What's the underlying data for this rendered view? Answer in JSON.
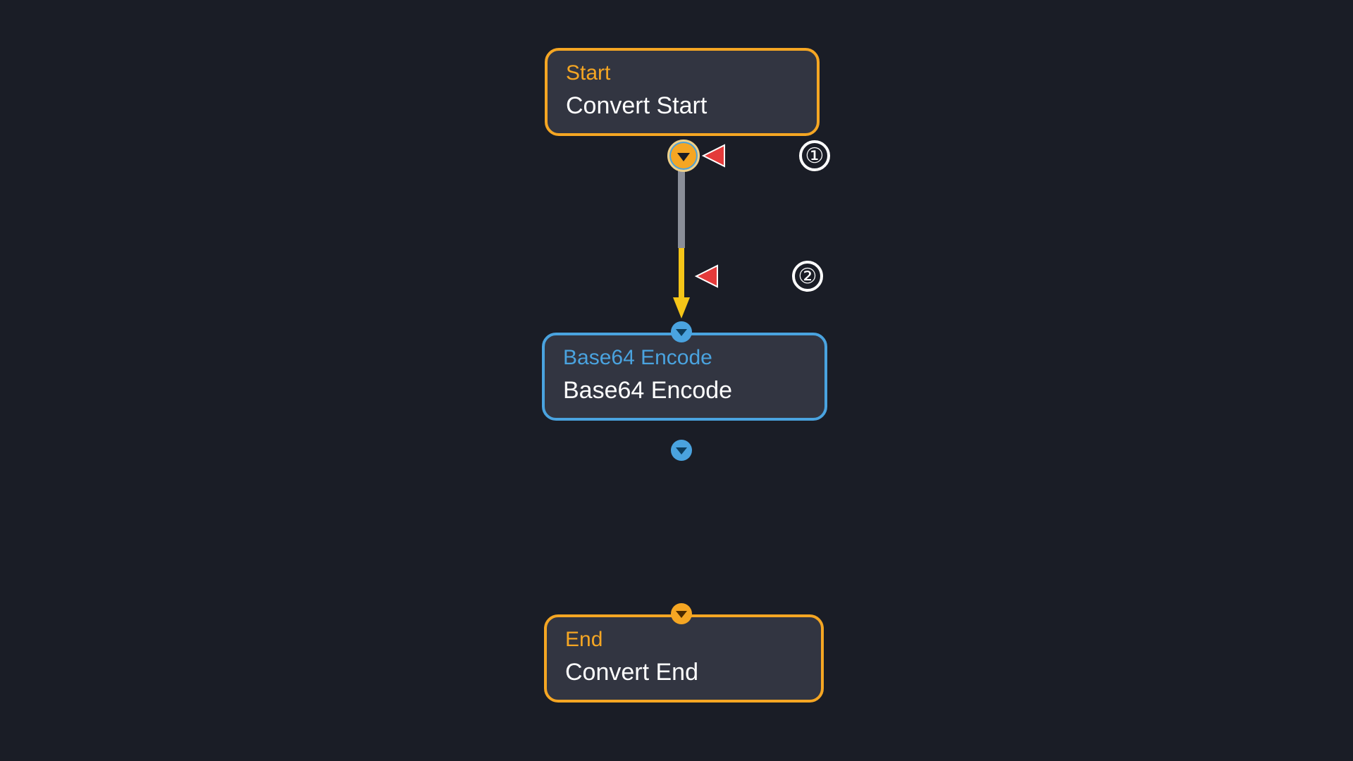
{
  "nodes": {
    "start": {
      "label": "Start",
      "title": "Convert Start"
    },
    "encode": {
      "label": "Base64 Encode",
      "title": "Base64 Encode"
    },
    "end": {
      "label": "End",
      "title": "Convert End"
    }
  },
  "annotations": {
    "one": "①",
    "two": "②"
  },
  "colors": {
    "bg": "#1a1d26",
    "orange": "#f5a623",
    "blue": "#4aa3df",
    "panel": "#323541"
  }
}
